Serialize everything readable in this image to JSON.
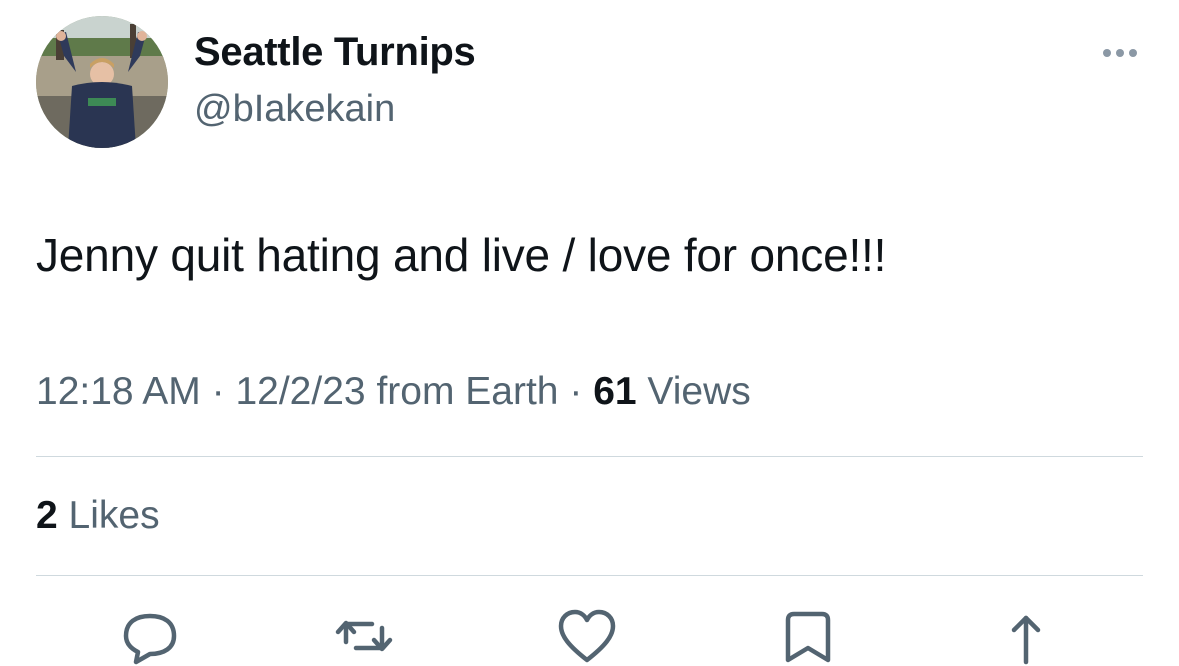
{
  "tweet": {
    "author": {
      "display_name": "Seattle Turnips",
      "handle": "@bIakekain",
      "avatar": "profile-photo"
    },
    "text": "Jenny quit hating and live / love for once!!!",
    "time": "12:18 AM",
    "date": "12/2/23",
    "source": "from Earth",
    "separator": "·",
    "views_count": "61",
    "views_label": "Views",
    "likes_count": "2",
    "likes_label": "Likes"
  },
  "actions": [
    {
      "icon": "reply-icon"
    },
    {
      "icon": "retweet-icon"
    },
    {
      "icon": "like-icon"
    },
    {
      "icon": "bookmark-icon"
    },
    {
      "icon": "share-icon"
    }
  ],
  "menu": {
    "icon": "more-options-icon"
  },
  "colors": {
    "text_primary": "#0f1419",
    "text_secondary": "#536471",
    "divider": "#cfd9de"
  }
}
